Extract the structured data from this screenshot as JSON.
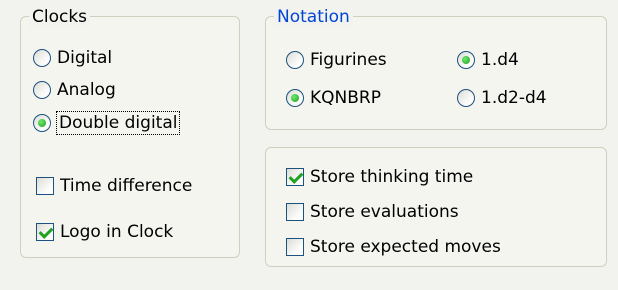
{
  "clocks": {
    "title": "Clocks",
    "options": [
      {
        "label": "Digital",
        "checked": false
      },
      {
        "label": "Analog",
        "checked": false
      },
      {
        "label": "Double digital",
        "checked": true
      }
    ],
    "time_difference": {
      "label": "Time difference",
      "checked": false
    },
    "logo_in_clock": {
      "label": "Logo in Clock",
      "checked": true
    }
  },
  "notation": {
    "title": "Notation",
    "options": [
      {
        "label": "Figurines",
        "checked": false
      },
      {
        "label": "1.d4",
        "checked": true
      },
      {
        "label": "KQNBRP",
        "checked": true
      },
      {
        "label": "1.d2-d4",
        "checked": false
      }
    ]
  },
  "store": {
    "options": [
      {
        "label": "Store thinking time",
        "checked": true
      },
      {
        "label": "Store evaluations",
        "checked": false
      },
      {
        "label": "Store expected moves",
        "checked": false
      }
    ]
  }
}
